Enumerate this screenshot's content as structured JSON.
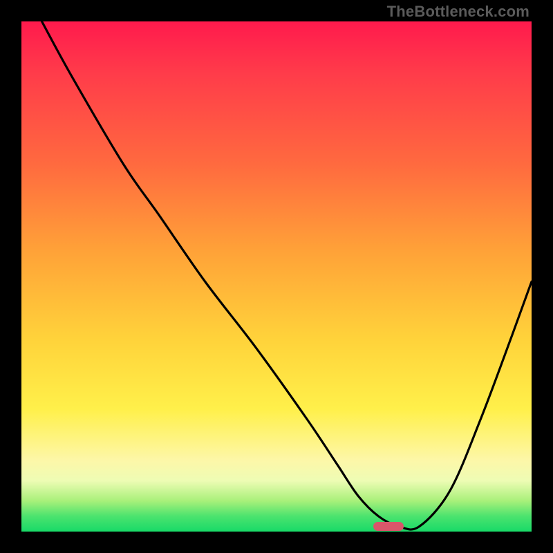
{
  "watermark": "TheBottleneck.com",
  "chart_data": {
    "type": "line",
    "title": "",
    "xlabel": "",
    "ylabel": "",
    "xlim": [
      0,
      100
    ],
    "ylim": [
      0,
      100
    ],
    "series": [
      {
        "name": "bottleneck-curve",
        "x": [
          4,
          10,
          20,
          27,
          36,
          46,
          56,
          62,
          66,
          70,
          74,
          78,
          84,
          90,
          96,
          100
        ],
        "y": [
          100,
          89,
          72,
          62,
          49,
          36,
          22,
          13,
          7,
          3,
          1,
          1,
          8,
          22,
          38,
          49
        ]
      }
    ],
    "marker": {
      "x_center": 72,
      "y": 1,
      "width_pct": 6
    },
    "gradient_stops": [
      {
        "pct": 0,
        "color": "#ff1a4d"
      },
      {
        "pct": 28,
        "color": "#ff6a3f"
      },
      {
        "pct": 62,
        "color": "#ffd23a"
      },
      {
        "pct": 86,
        "color": "#fdf7a8"
      },
      {
        "pct": 100,
        "color": "#18da68"
      }
    ]
  }
}
